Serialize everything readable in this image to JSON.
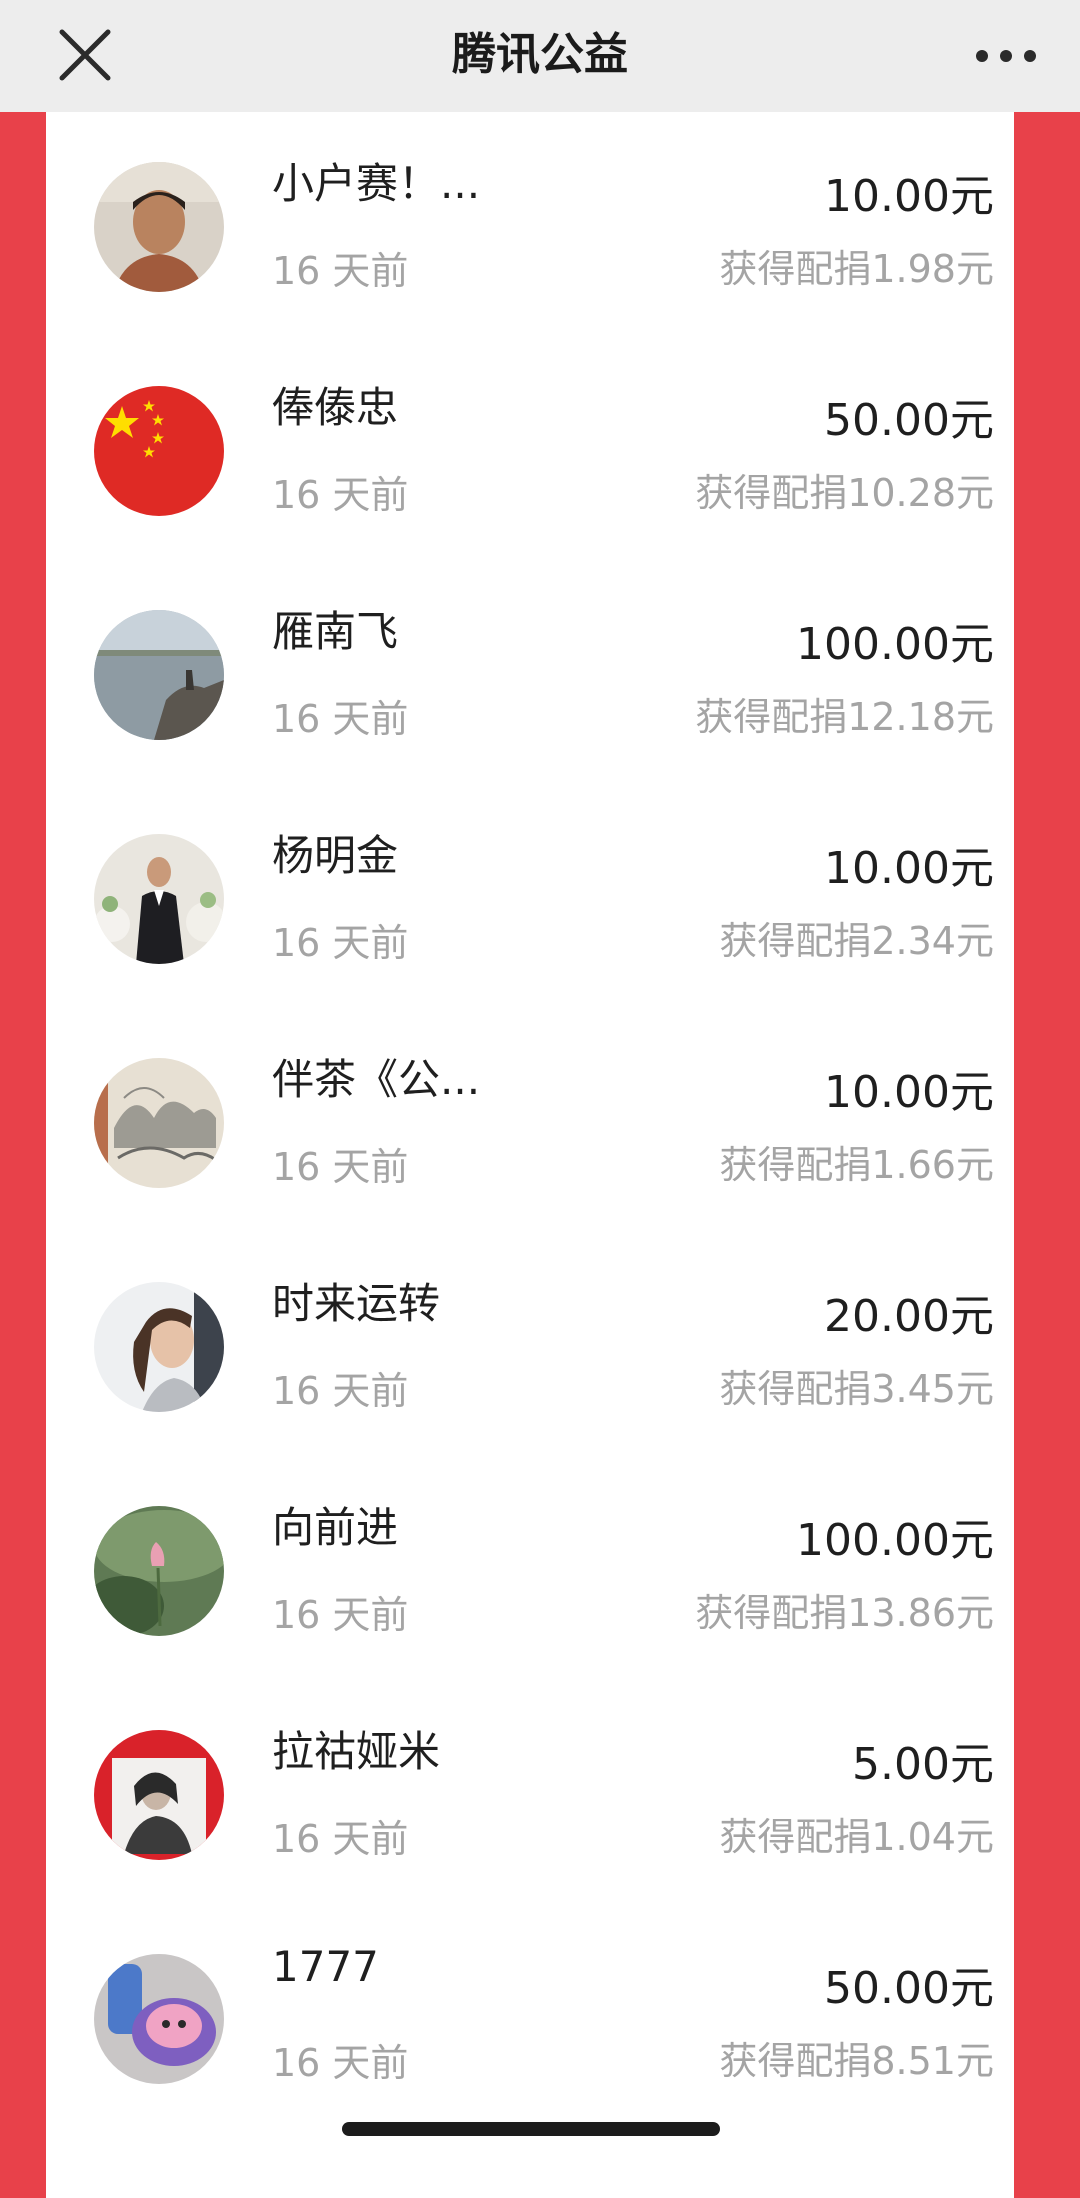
{
  "header": {
    "title": "腾讯公益",
    "close_icon": "close-icon",
    "more_icon": "more-icon"
  },
  "colors": {
    "page_background": "#e8414a",
    "panel": "#ffffff",
    "primary_text": "#1f1f1f",
    "secondary_text": "#a4a4a4"
  },
  "donations": [
    {
      "name": "小户赛！...",
      "time": "16 天前",
      "amount": "10.00元",
      "match": "获得配捐1.98元",
      "avatar": "man-portrait-avatar"
    },
    {
      "name": "俸傣忠",
      "time": "16 天前",
      "amount": "50.00元",
      "match": "获得配捐10.28元",
      "avatar": "flag-avatar"
    },
    {
      "name": "雁南飞",
      "time": "16 天前",
      "amount": "100.00元",
      "match": "获得配捐12.18元",
      "avatar": "river-landscape-avatar"
    },
    {
      "name": "杨明金",
      "time": "16 天前",
      "amount": "10.00元",
      "match": "获得配捐2.34元",
      "avatar": "suit-man-avatar"
    },
    {
      "name": "伴茶《公...",
      "time": "16 天前",
      "amount": "10.00元",
      "match": "获得配捐1.66元",
      "avatar": "painting-avatar"
    },
    {
      "name": "时来运转",
      "time": "16 天前",
      "amount": "20.00元",
      "match": "获得配捐3.45元",
      "avatar": "woman-avatar"
    },
    {
      "name": "向前进",
      "time": "16 天前",
      "amount": "100.00元",
      "match": "获得配捐13.86元",
      "avatar": "lotus-avatar"
    },
    {
      "name": "拉祜娅米",
      "time": "16 天前",
      "amount": "5.00元",
      "match": "获得配捐1.04元",
      "avatar": "magazine-avatar"
    },
    {
      "name": "1777",
      "time": "16 天前",
      "amount": "50.00元",
      "match": "获得配捐8.51元",
      "avatar": "toy-avatar"
    }
  ]
}
